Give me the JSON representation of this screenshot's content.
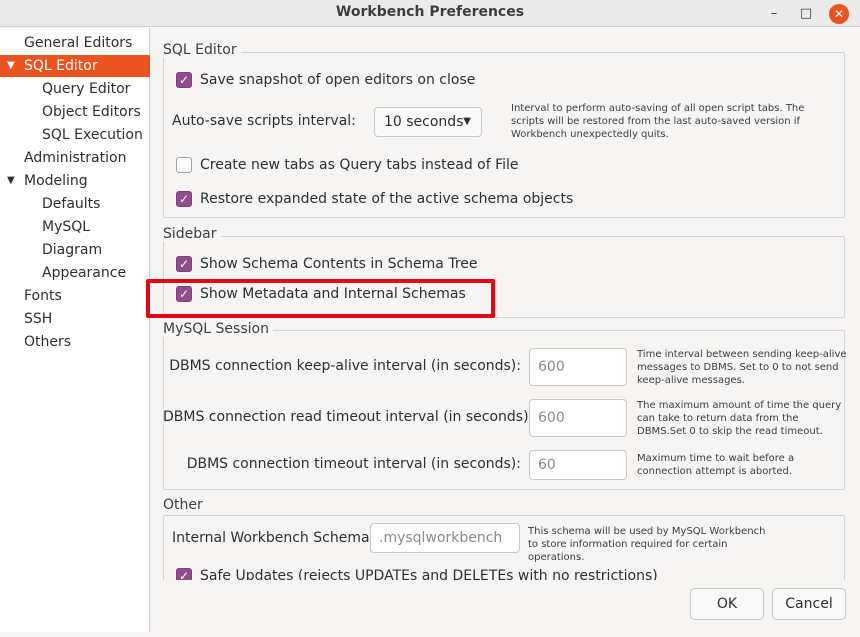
{
  "window": {
    "title": "Workbench Preferences",
    "minimize_glyph": "–",
    "maximize_glyph": "□",
    "close_glyph": "✕"
  },
  "sidebar": {
    "items": [
      {
        "label": "General Editors",
        "level": 0
      },
      {
        "label": "SQL Editor",
        "level": 0,
        "expanded": true,
        "selected": true
      },
      {
        "label": "Query Editor",
        "level": 1
      },
      {
        "label": "Object Editors",
        "level": 1
      },
      {
        "label": "SQL Execution",
        "level": 1
      },
      {
        "label": "Administration",
        "level": 0
      },
      {
        "label": "Modeling",
        "level": 0,
        "expanded": true
      },
      {
        "label": "Defaults",
        "level": 1
      },
      {
        "label": "MySQL",
        "level": 1
      },
      {
        "label": "Diagram",
        "level": 1
      },
      {
        "label": "Appearance",
        "level": 1
      },
      {
        "label": "Fonts",
        "level": 0
      },
      {
        "label": "SSH",
        "level": 0
      },
      {
        "label": "Others",
        "level": 0
      }
    ],
    "expanded_arrow": "▼"
  },
  "sql_editor": {
    "group_title": "SQL Editor",
    "save_snapshot": {
      "label": "Save snapshot of open editors on close",
      "checked": true
    },
    "autosave": {
      "label": "Auto-save scripts interval:",
      "value": "10 seconds",
      "hint": "Interval to perform auto-saving of all open script tabs. The scripts will be restored from the last auto-saved version if Workbench unexpectedly quits."
    },
    "query_tabs": {
      "label": "Create new tabs as Query tabs instead of File",
      "checked": false
    },
    "restore_state": {
      "label": "Restore expanded state of the active schema objects",
      "checked": true
    }
  },
  "sidebar_group": {
    "group_title": "Sidebar",
    "schema_contents": {
      "label": "Show Schema Contents in Schema Tree",
      "checked": true
    },
    "metadata": {
      "label": "Show Metadata and Internal Schemas",
      "checked": true
    }
  },
  "mysql_session": {
    "group_title": "MySQL Session",
    "keepalive": {
      "label": "DBMS connection keep-alive interval (in seconds):",
      "value": "600",
      "hint": "Time interval between sending keep-alive messages to DBMS. Set to 0 to not send keep-alive messages."
    },
    "read_timeout": {
      "label": "DBMS connection read timeout interval (in seconds):",
      "value": "600",
      "hint": "The maximum amount of time the query can take to return data from the DBMS.Set 0 to skip the read timeout."
    },
    "conn_timeout": {
      "label": "DBMS connection timeout interval (in seconds):",
      "value": "60",
      "hint": "Maximum time to wait before a connection attempt is aborted."
    }
  },
  "other": {
    "group_title": "Other",
    "schema": {
      "label": "Internal Workbench Schema:",
      "placeholder": ".mysqlworkbench",
      "hint": "This schema will be used by MySQL Workbench to store information required for certain operations."
    },
    "safe_updates": {
      "label": "Safe Updates (rejects UPDATEs and DELETEs with no restrictions)",
      "checked": true
    }
  },
  "buttons": {
    "ok": "OK",
    "cancel": "Cancel"
  },
  "check_glyph": "✓",
  "colors": {
    "accent": "#e95420",
    "checkbox": "#924d8b",
    "highlight": "#e30613"
  }
}
